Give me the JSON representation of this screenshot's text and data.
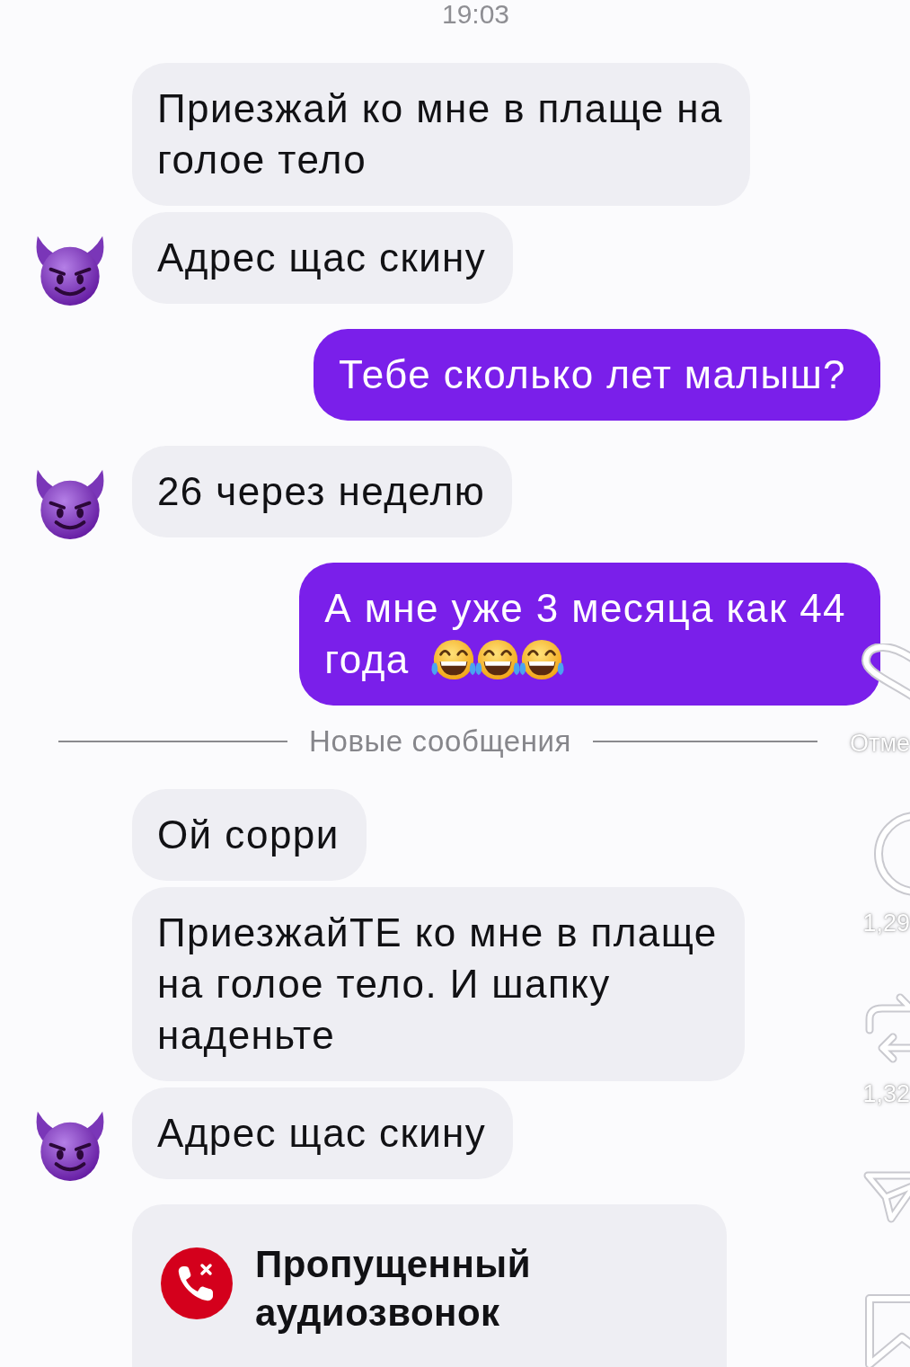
{
  "chat": {
    "items": [
      {
        "kind": "time",
        "text": "19:03"
      },
      {
        "kind": "incoming_message",
        "text": "Приезжай ко мне в плаще на\nголое тело",
        "avatar": false
      },
      {
        "kind": "incoming_message",
        "text": "Адрес щас скину",
        "avatar": true
      },
      {
        "kind": "outgoing_message",
        "text": "Тебе сколько лет малыш?",
        "avatar": false
      },
      {
        "kind": "incoming_message",
        "text": "26 через неделю",
        "avatar": true
      },
      {
        "kind": "outgoing_message",
        "text": "А мне уже 3 месяца как 44",
        "emoji_line": {
          "text": "года",
          "emojis": [
            {
              "kind": "tears_of_joy"
            },
            {
              "kind": "tears_of_joy"
            },
            {
              "kind": "tears_of_joy"
            }
          ]
        },
        "avatar": false
      },
      {
        "kind": "divider",
        "text": "Новые сообщения"
      },
      {
        "kind": "incoming_message",
        "text": "Ой сорри",
        "avatar": false
      },
      {
        "kind": "incoming_message",
        "text": "ПриезжайТЕ ко мне в плаще\nна голое тело. И шапку\nнаденьте",
        "avatar": false
      },
      {
        "kind": "incoming_message",
        "text": "Адрес щас скину",
        "avatar": true
      },
      {
        "kind": "call",
        "text": "Пропущенный\nаудиозвонок",
        "missed": true
      }
    ]
  },
  "side_actions": [
    {
      "kind": "heart",
      "label": "Отме"
    },
    {
      "kind": "comment",
      "label": "1,29"
    },
    {
      "kind": "repost",
      "label": "1,32"
    },
    {
      "kind": "send"
    },
    {
      "kind": "bookmark"
    }
  ]
}
